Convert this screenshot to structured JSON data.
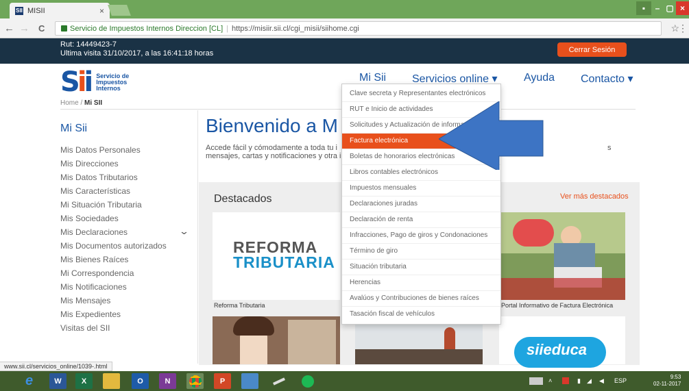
{
  "browser": {
    "tab_title": "MISII",
    "tab_favicon": "SII",
    "tab_close": "×",
    "site_identity": "Servicio de Impuestos Internos Direccion [CL]",
    "url": "https://misiir.sii.cl/cgi_misii/siihome.cgi",
    "status_url": "www.sii.cl/servicios_online/1039-.html",
    "back": "←",
    "forward": "→",
    "reload": "C",
    "star": "☆",
    "menu": "⋮",
    "win_min": "–",
    "win_max": "▢",
    "win_close": "×"
  },
  "header": {
    "rut": "Rut: 14449423-7",
    "last_visit": "Ultima visita 31/10/2017, a las 16:41:18 horas",
    "logout": "Cerrar Sesión",
    "logo_text": [
      "Servicio de",
      "Impuestos",
      "Internos"
    ]
  },
  "nav": {
    "mi_sii": "Mi Sii",
    "servicios": "Servicios online ▾",
    "ayuda": "Ayuda",
    "contacto": "Contacto ▾"
  },
  "breadcrumb": {
    "home": "Home",
    "sep": "/",
    "current": "Mi SII"
  },
  "sidebar": {
    "title": "Mi Sii",
    "items": [
      "Mis Datos Personales",
      "Mis Direcciones",
      "Mis Datos Tributarios",
      "Mis Características",
      "Mi Situación Tributaria",
      "Mis Sociedades",
      "Mis Declaraciones",
      "Mis Documentos autorizados",
      "Mis Bienes Raíces",
      "Mi Correspondencia",
      "Mis Notificaciones",
      "Mis Mensajes",
      "Mis Expedientes",
      "Visitas del SII"
    ]
  },
  "main": {
    "welcome": "Bienvenido a M",
    "intro_line1": "Accede fácil y cómodamente a toda tu i",
    "intro_line2": "mensajes, cartas y notificaciones y otra i",
    "intro_tail": "s",
    "featured_title": "Destacados",
    "see_more": "Ver más destacados",
    "reforma_line1": "REFORMA",
    "reforma_line2": "TRIBUTARIA",
    "caption1": "Reforma Tributaria",
    "caption3": "Portal Informativo de Factura Electrónica",
    "educa": "siieduca"
  },
  "dropdown": {
    "items": [
      "Clave secreta y Representantes electrónicos",
      "RUT e Inicio de actividades",
      "Solicitudes y Actualización de información",
      "Factura electrónica",
      "Boletas de honorarios electrónicas",
      "Libros contables electrónicos",
      "Impuestos mensuales",
      "Declaraciones juradas",
      "Declaración de renta",
      "Infracciones, Pago de giros y Condonaciones",
      "Término de giro",
      "Situación tributaria",
      "Herencias",
      "Avalúos y Contribuciones de bienes raíces",
      "Tasación fiscal de vehículos"
    ],
    "active_index": 3
  },
  "taskbar": {
    "apps": [
      "e",
      "W",
      "X",
      "",
      "O",
      "N",
      "",
      "P",
      "",
      "",
      ""
    ],
    "lang": "ESP",
    "time": "9:53",
    "date": "02-11-2017"
  },
  "colors": {
    "accent": "#e8501c",
    "brand_blue": "#1a56a4",
    "dark_bar": "#1a3245",
    "arrow": "#3d74c4"
  }
}
